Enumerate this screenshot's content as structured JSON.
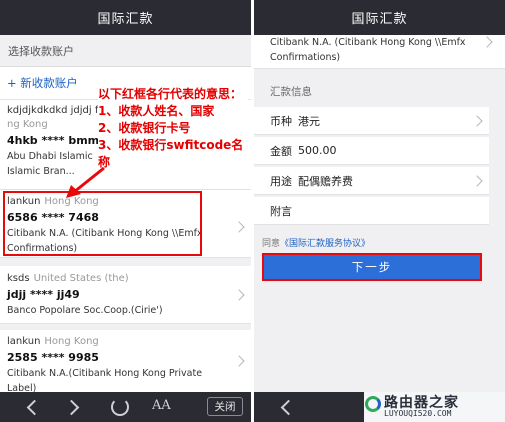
{
  "left_panel": {
    "title": "国际汇款",
    "section_header": "选择收款账户",
    "add_account": "+ 新收款账户",
    "accounts": [
      {
        "name": "kdjdjkdkdkd jdjdj f",
        "country": "ng Kong",
        "card": "4hkb **** bmmm",
        "bank": "Abu Dhabi Islamic Islamic Bran..."
      },
      {
        "name": "lankun",
        "country": "Hong Kong",
        "card": "6586 **** 7468",
        "bank": "Citibank N.A. (Citibank Hong Kong \\\\Emfx Confirmations)"
      },
      {
        "name": "ksds",
        "country": "United States (the)",
        "card": "jdjj **** jj49",
        "bank": "Banco Popolare Soc.Coop.(Cirie')"
      },
      {
        "name": "lankun",
        "country": "Hong Kong",
        "card": "2585 **** 9985",
        "bank": "Citibank N.A.(Citibank Hong Kong Private Label)"
      }
    ],
    "annotation": {
      "title": "以下红框各行代表的意思：",
      "line1": "1、收款人姓名、国家",
      "line2": "2、收款银行卡号",
      "line3": "3、收款银行swfitcode名称"
    },
    "close_label": "关闭",
    "font_size_label": "AA"
  },
  "right_panel": {
    "title": "国际汇款",
    "bank_top": "Citibank N.A. (Citibank Hong Kong \\\\Emfx Confirmations)",
    "info_title": "汇款信息",
    "rows": [
      {
        "label": "币种",
        "value": "港元"
      },
      {
        "label": "金额",
        "value": "500.00"
      },
      {
        "label": "用途",
        "value": "配偶赡养费"
      },
      {
        "label": "附言",
        "value": ""
      }
    ],
    "agree_prefix": "同意",
    "agree_link": "《国际汇款服务协议》",
    "submit_label": "下一步"
  },
  "watermark": {
    "main": "路由器之家",
    "sub": "LUYOUQI520.COM"
  },
  "colors": {
    "titlebar": "#2a2b33",
    "accent": "#1d62c4",
    "button": "#2d6fd8",
    "highlight": "#e80a0a"
  }
}
